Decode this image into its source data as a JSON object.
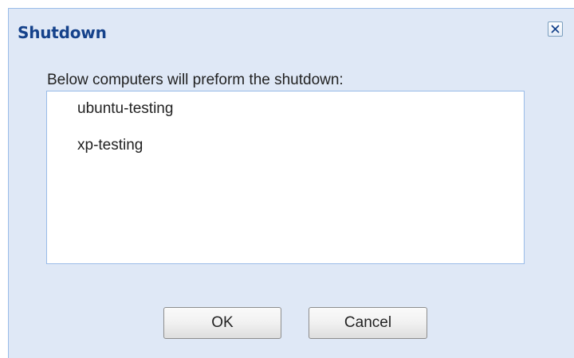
{
  "dialog": {
    "title": "Shutdown",
    "close_icon": "close-icon",
    "intro_text": "Below computers will preform the shutdown:",
    "computers": [
      "ubuntu-testing",
      "xp-testing"
    ],
    "ok_label": "OK",
    "cancel_label": "Cancel"
  },
  "colors": {
    "dialog_background": "#dfe8f6",
    "title_text": "#15428b",
    "border": "#99bbe8",
    "list_background": "#ffffff"
  }
}
